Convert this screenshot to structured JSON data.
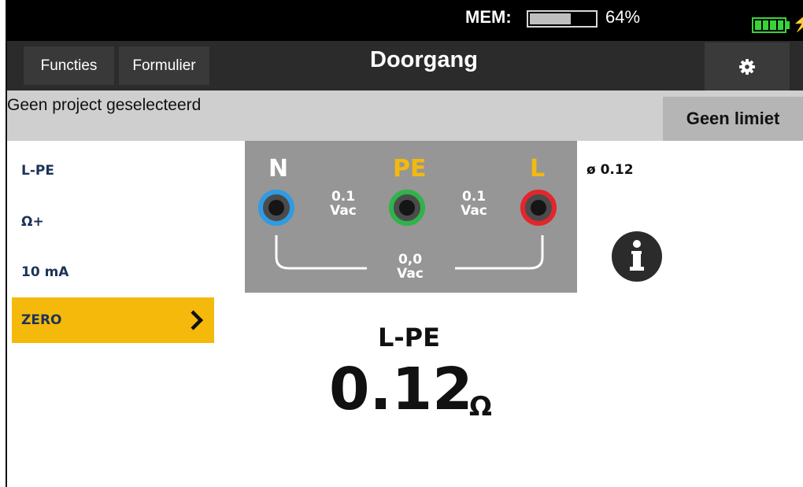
{
  "status_bar": {
    "mem_label": "MEM:",
    "mem_percent": "64%",
    "mem_fill_fraction": 0.64,
    "battery_icon": "battery-icon",
    "charge_icon": "lightning-icon",
    "battery_color": "#3ad33a"
  },
  "nav": {
    "functions_label": "Functies",
    "form_label": "Formulier",
    "title": "Doorgang",
    "settings_icon": "gear-icon"
  },
  "info_bar": {
    "project_text": "Geen project geselecteerd",
    "limit_label": "Geen limiet"
  },
  "side_menu": {
    "items": [
      "L-PE",
      "Ω+",
      "10 mA"
    ],
    "zero_label": "ZERO",
    "zero_color": "#f5b90c"
  },
  "diagram": {
    "terminals": [
      {
        "label": "N",
        "color": "#2f9be3"
      },
      {
        "label": "PE",
        "color": "#f5b90c"
      },
      {
        "label": "L",
        "color": "#e3262b"
      }
    ],
    "terminal_ring_colors": {
      "N": "#2f9be3",
      "PE": "#2fb34a",
      "L": "#e3262b"
    },
    "readings": [
      {
        "value": "0.1",
        "unit": "Vac"
      },
      {
        "value": "0.1",
        "unit": "Vac"
      },
      {
        "value": "0,0",
        "unit": "Vac"
      }
    ]
  },
  "side_info": {
    "average": "ø 0.12",
    "info_icon": "info-icon"
  },
  "result": {
    "label": "L-PE",
    "value": "0.12",
    "unit": "Ω"
  }
}
